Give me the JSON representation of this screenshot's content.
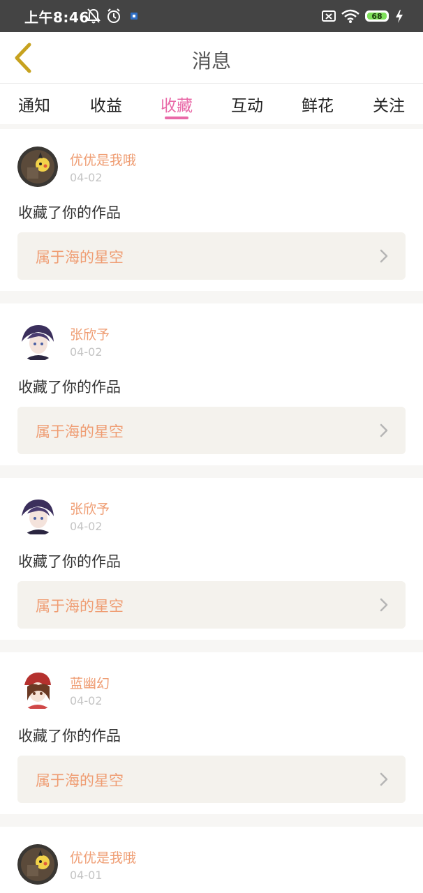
{
  "status_bar": {
    "time": "上午8:46",
    "icons": [
      "mute-bell-icon",
      "alarm-icon",
      "app-notification-icon",
      "sim-off-icon",
      "wifi-icon",
      "battery-icon",
      "charging-icon"
    ],
    "battery_level": "68"
  },
  "header": {
    "title": "消息",
    "back_icon": "chevron-left-icon"
  },
  "tabs": [
    {
      "label": "通知"
    },
    {
      "label": "收益"
    },
    {
      "label": "收藏",
      "active": true
    },
    {
      "label": "互动"
    },
    {
      "label": "鲜花"
    },
    {
      "label": "关注"
    }
  ],
  "messages": [
    {
      "username": "优优是我哦",
      "date": "04-02",
      "action": "收藏了你的作品",
      "work_title": "属于海的星空"
    },
    {
      "username": "张欣予",
      "date": "04-02",
      "action": "收藏了你的作品",
      "work_title": "属于海的星空"
    },
    {
      "username": "张欣予",
      "date": "04-02",
      "action": "收藏了你的作品",
      "work_title": "属于海的星空"
    },
    {
      "username": "蓝幽幻",
      "date": "04-02",
      "action": "收藏了你的作品",
      "work_title": "属于海的星空"
    },
    {
      "username": "优优是我哦",
      "date": "04-01"
    }
  ],
  "colors": {
    "accent": "#e96aa8",
    "username": "#ef9d73",
    "work_title": "#ef9d73",
    "back_arrow": "#c7a21f"
  }
}
